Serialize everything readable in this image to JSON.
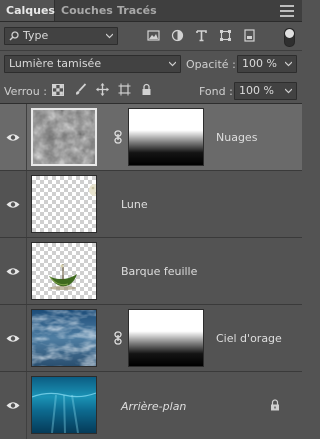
{
  "tabs": [
    {
      "label": "Calques",
      "active": true
    },
    {
      "label": "Couches",
      "active": false
    },
    {
      "label": "Tracés",
      "active": false
    }
  ],
  "filter": {
    "kind_label": "Type",
    "icons": [
      "pixel-filter-icon",
      "adjustment-filter-icon",
      "type-filter-icon",
      "shape-filter-icon",
      "smart-object-filter-icon"
    ]
  },
  "blend": {
    "mode": "Lumière tamisée",
    "opacity_label": "Opacité :",
    "opacity_value": "100 %"
  },
  "lock": {
    "label": "Verrou :",
    "fill_label": "Fond :",
    "fill_value": "100 %",
    "icons": [
      "lock-transparent-icon",
      "lock-image-icon",
      "lock-position-icon",
      "lock-artboard-icon",
      "lock-all-icon"
    ]
  },
  "layers": [
    {
      "name": "Nuages",
      "selected": true,
      "visible": true,
      "has_mask": true,
      "thumb": "clouds"
    },
    {
      "name": "Lune",
      "selected": false,
      "visible": true,
      "has_mask": false,
      "thumb": "moon"
    },
    {
      "name": "Barque feuille",
      "selected": false,
      "visible": true,
      "has_mask": false,
      "thumb": "boat"
    },
    {
      "name": "Ciel d'orage",
      "selected": false,
      "visible": true,
      "has_mask": true,
      "thumb": "stormsky"
    },
    {
      "name": "Arrière-plan",
      "selected": false,
      "visible": true,
      "has_mask": false,
      "thumb": "underwater",
      "locked": true,
      "italic": true
    }
  ],
  "colors": {
    "panel_bg": "#535353",
    "tab_bar_bg": "#3f3f3f",
    "selected_row": "#6a6a6a"
  }
}
